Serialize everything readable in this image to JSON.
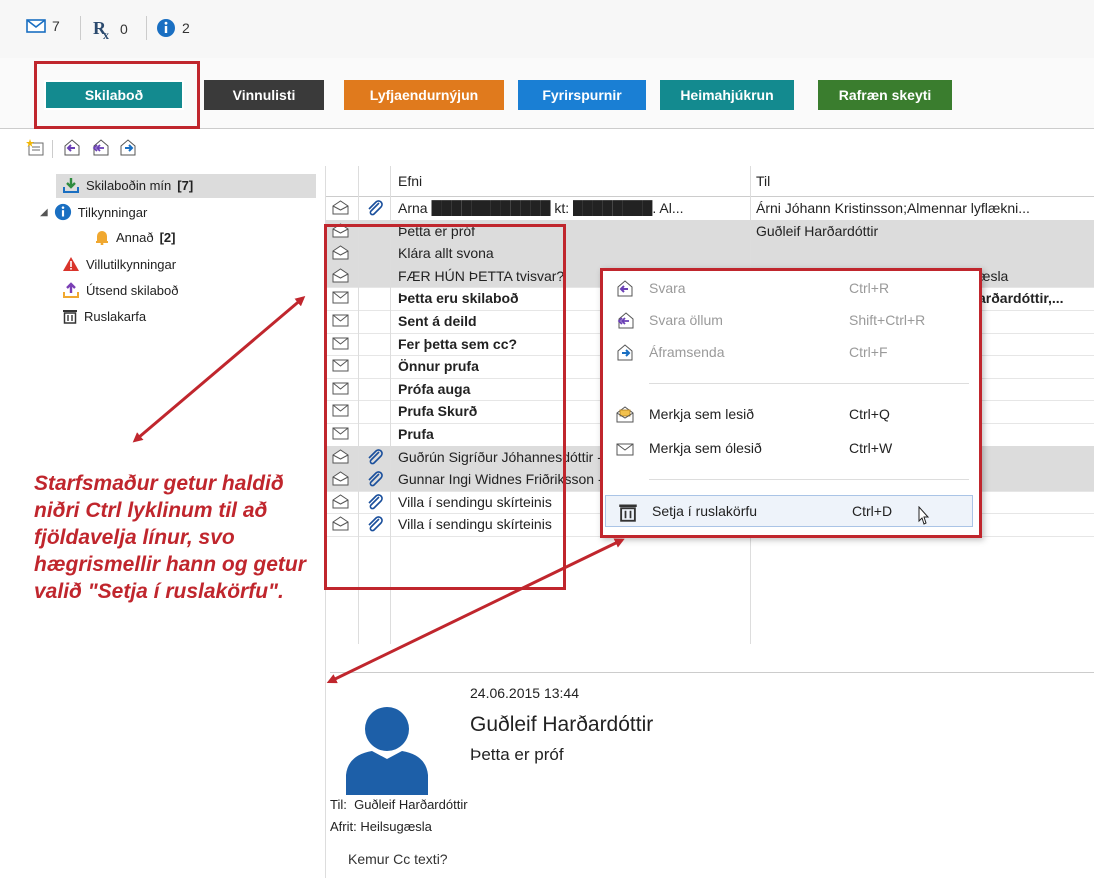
{
  "status_bar": {
    "messages_count": "7",
    "prescriptions_count": "0",
    "info_count": "2"
  },
  "nav_buttons": [
    {
      "label": "Skilaboð",
      "color": "#138a8f"
    },
    {
      "label": "Vinnulisti",
      "color": "#3a3a3a"
    },
    {
      "label": "Lyfjaendurnýjun",
      "color": "#e07a1d"
    },
    {
      "label": "Fyrirspurnir",
      "color": "#1a7fd4"
    },
    {
      "label": "Heimahjúkrun",
      "color": "#138a8f"
    },
    {
      "label": "Rafræn skeyti",
      "color": "#3a7d2e"
    }
  ],
  "folders": {
    "my_messages": {
      "label": "Skilaboðin mín",
      "count": "[7]"
    },
    "notifications": {
      "label": "Tilkynningar"
    },
    "other": {
      "label": "Annað",
      "count": "[2]"
    },
    "errors": {
      "label": "Villutilkynningar"
    },
    "sent": {
      "label": "Útsend skilaboð"
    },
    "trash": {
      "label": "Ruslakarfa"
    }
  },
  "list": {
    "headers": {
      "subject": "Efni",
      "to": "Til"
    },
    "rows": [
      {
        "subject": "Arna ████████████ kt: ████████. Al...",
        "to": "Árni Jóhann Kristinsson;Almennar lyflækni...",
        "read": true,
        "attachment": true,
        "bold": false,
        "selected": false
      },
      {
        "subject": "Þetta er próf",
        "to": "Guðleif Harðardóttir",
        "read": true,
        "attachment": false,
        "bold": false,
        "selected": true
      },
      {
        "subject": "Klára allt svona",
        "to": "",
        "read": true,
        "attachment": false,
        "bold": false,
        "selected": true
      },
      {
        "subject": "FÆR HÚN ÞETTA tvisvar?",
        "to": "",
        "read": true,
        "attachment": false,
        "bold": false,
        "selected": true
      },
      {
        "subject": "Þetta eru skilaboð",
        "to": "",
        "read": false,
        "attachment": false,
        "bold": true,
        "selected": false
      },
      {
        "subject": "Sent á deild",
        "to": "",
        "read": false,
        "attachment": false,
        "bold": true,
        "selected": false
      },
      {
        "subject": "Fer þetta sem cc?",
        "to": "",
        "read": false,
        "attachment": false,
        "bold": true,
        "selected": false
      },
      {
        "subject": "Önnur prufa",
        "to": "",
        "read": false,
        "attachment": false,
        "bold": true,
        "selected": false
      },
      {
        "subject": "Prófa auga",
        "to": "",
        "read": false,
        "attachment": false,
        "bold": true,
        "selected": false
      },
      {
        "subject": "Prufa Skurð",
        "to": "",
        "read": false,
        "attachment": false,
        "bold": true,
        "selected": false
      },
      {
        "subject": "Prufa",
        "to": "",
        "read": false,
        "attachment": false,
        "bold": true,
        "selected": false
      },
      {
        "subject": "Guðrún Sigríður Jóhannesdóttir - Beiðni sa...",
        "to": "Guðrún Sigríður Jóhannesdóttir",
        "read": true,
        "attachment": true,
        "bold": false,
        "selected": true
      },
      {
        "subject": "Gunnar Ingi Widnes Friðriksson - Læknabr...",
        "to": "Guðrún Sigríður Jóhannesdóttir",
        "read": true,
        "attachment": true,
        "bold": false,
        "selected": true
      },
      {
        "subject": "Villa í sendingu skírteinis",
        "to": "Guðrún Sigríður Jóhannesdóttir",
        "read": true,
        "attachment": true,
        "bold": false,
        "selected": false
      },
      {
        "subject": "Villa í sendingu skírteinis",
        "to": "Guðrún Sigríður Jóhannesdóttir",
        "read": true,
        "attachment": true,
        "bold": false,
        "selected": false
      }
    ],
    "partial_to": {
      "row4": "æsla",
      "row5": "arðardóttir,..."
    }
  },
  "context_menu": {
    "reply": {
      "label": "Svara",
      "shortcut": "Ctrl+R"
    },
    "reply_all": {
      "label": "Svara öllum",
      "shortcut": "Shift+Ctrl+R"
    },
    "forward": {
      "label": "Áframsenda",
      "shortcut": "Ctrl+F"
    },
    "mark_read": {
      "label": "Merkja sem lesið",
      "shortcut": "Ctrl+Q"
    },
    "mark_unread": {
      "label": "Merkja sem ólesið",
      "shortcut": "Ctrl+W"
    },
    "trash": {
      "label": "Setja í ruslakörfu",
      "shortcut": "Ctrl+D"
    }
  },
  "preview": {
    "date": "24.06.2015 13:44",
    "sender": "Guðleif Harðardóttir",
    "subject": "Þetta er próf",
    "to_label": "Til:",
    "to_value": "Guðleif Harðardóttir",
    "cc_label": "Afrit:",
    "cc_value": "Heilsugæsla",
    "body": "Kemur Cc texti?"
  },
  "annotation": {
    "text": "Starfsmaður getur haldið niðri Ctrl lyklinum til að fjöldavelja línur, svo hægrismellir hann og getur valið \"Setja í ruslakörfu\"."
  },
  "colors": {
    "highlight_red": "#c0262d",
    "selected_row": "#dcdcdc"
  }
}
